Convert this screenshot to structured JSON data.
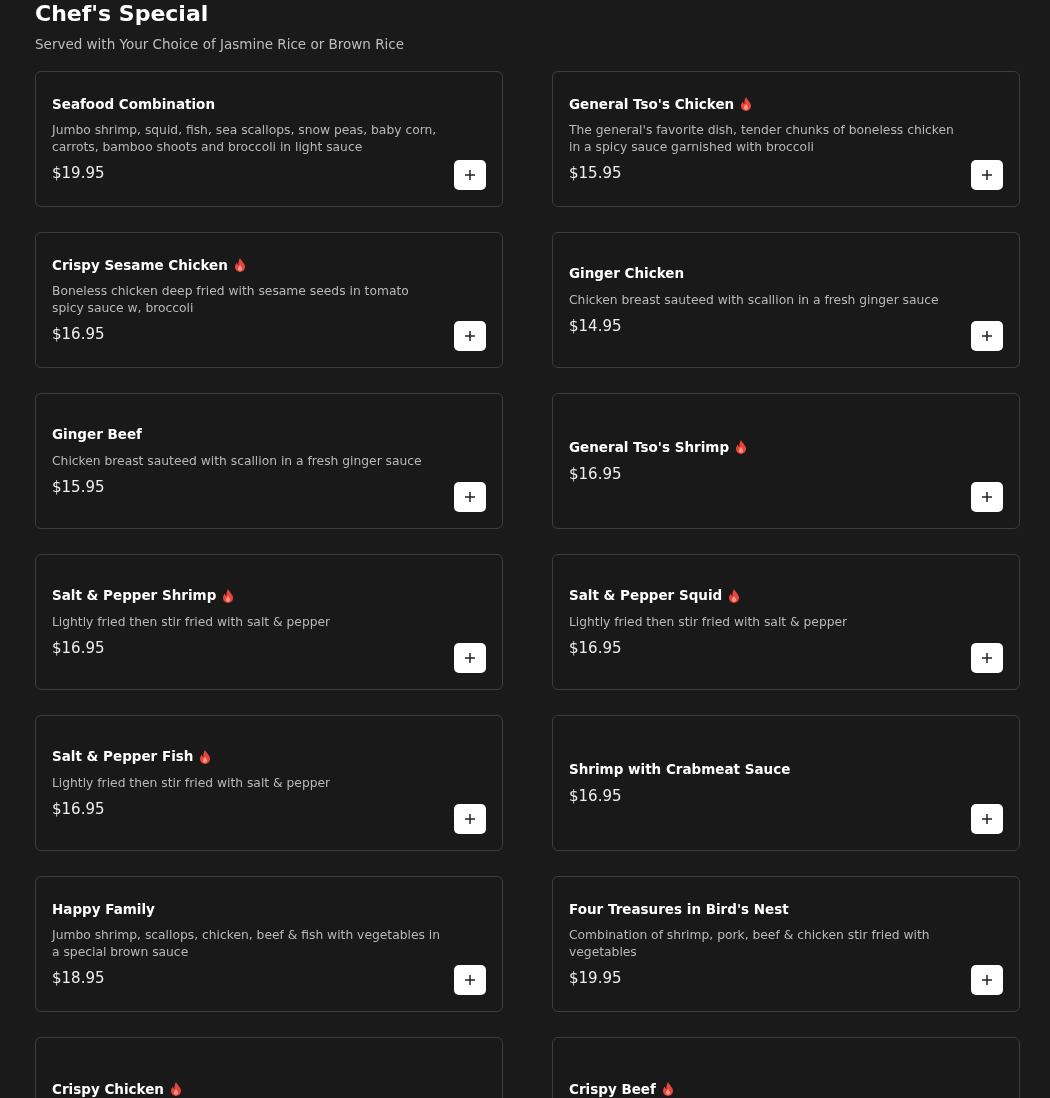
{
  "section": {
    "title": "Chef's Special",
    "subtitle": "Served with Your Choice of Jasmine Rice or Brown Rice"
  },
  "items": [
    {
      "name": "Seafood Combination",
      "spicy": false,
      "description": "Jumbo shrimp, squid, fish, sea scallops, snow peas, baby corn, carrots, bamboo shoots and broccoli in light sauce",
      "price": "$19.95"
    },
    {
      "name": "General Tso's Chicken",
      "spicy": true,
      "description": "The general's favorite dish, tender chunks of boneless chicken in a spicy sauce garnished with broccoli",
      "price": "$15.95"
    },
    {
      "name": "Crispy Sesame Chicken",
      "spicy": true,
      "description": "Boneless chicken deep fried with sesame seeds in tomato spicy sauce w, broccoli",
      "price": "$16.95"
    },
    {
      "name": "Ginger Chicken",
      "spicy": false,
      "description": "Chicken breast sauteed with scallion in a fresh ginger sauce",
      "price": "$14.95"
    },
    {
      "name": "Ginger Beef",
      "spicy": false,
      "description": "Chicken breast sauteed with scallion in a fresh ginger sauce",
      "price": "$15.95"
    },
    {
      "name": "General Tso's Shrimp",
      "spicy": true,
      "price": "$16.95"
    },
    {
      "name": "Salt & Pepper Shrimp",
      "spicy": true,
      "description": "Lightly fried then stir fried with salt & pepper",
      "price": "$16.95"
    },
    {
      "name": "Salt & Pepper Squid",
      "spicy": true,
      "description": "Lightly fried then stir fried with salt & pepper",
      "price": "$16.95"
    },
    {
      "name": "Salt & Pepper Fish",
      "spicy": true,
      "description": "Lightly fried then stir fried with salt & pepper",
      "price": "$16.95"
    },
    {
      "name": "Shrimp with Crabmeat Sauce",
      "spicy": false,
      "price": "$16.95"
    },
    {
      "name": "Happy Family",
      "spicy": false,
      "description": "Jumbo shrimp, scallops, chicken, beef & fish with vegetables in a special brown sauce",
      "price": "$18.95"
    },
    {
      "name": "Four Treasures in Bird's Nest",
      "spicy": false,
      "description": "Combination of shrimp, pork, beef & chicken stir fried with vegetables",
      "price": "$19.95"
    },
    {
      "name": "Crispy Chicken",
      "spicy": true
    },
    {
      "name": "Crispy Beef",
      "spicy": true
    }
  ]
}
